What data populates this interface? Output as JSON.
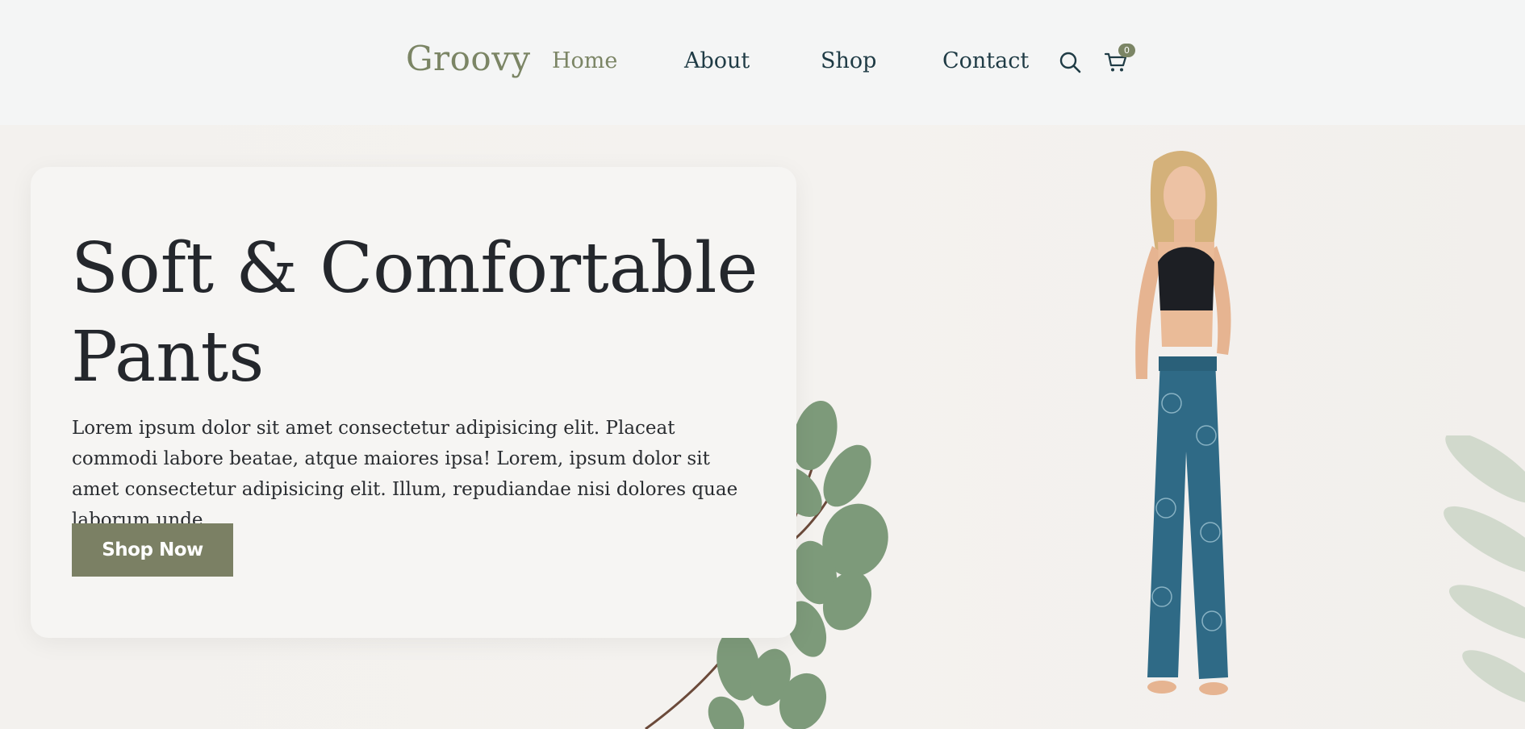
{
  "header": {
    "logo": "Groovy",
    "nav": [
      {
        "label": "Home",
        "active": true
      },
      {
        "label": "About"
      },
      {
        "label": "Shop"
      },
      {
        "label": "Contact"
      }
    ],
    "search_icon": "search-icon",
    "cart_icon": "cart-icon",
    "cart_count": "0"
  },
  "hero": {
    "title_line1": "Soft & Comfortable",
    "title_line2": "Pants",
    "description": "Lorem ipsum dolor sit amet consectetur adipisicing elit. Placeat commodi labore beatae, atque maiores ipsa! Lorem, ipsum dolor sit amet consectetur adipisicing elit. Illum, repudiandae nisi dolores quae laborum unde",
    "button_label": "Shop Now"
  },
  "colors": {
    "accent": "#7b8565",
    "nav_text": "#1f3b45",
    "button_bg": "#7b8064",
    "heading": "#24272c"
  }
}
